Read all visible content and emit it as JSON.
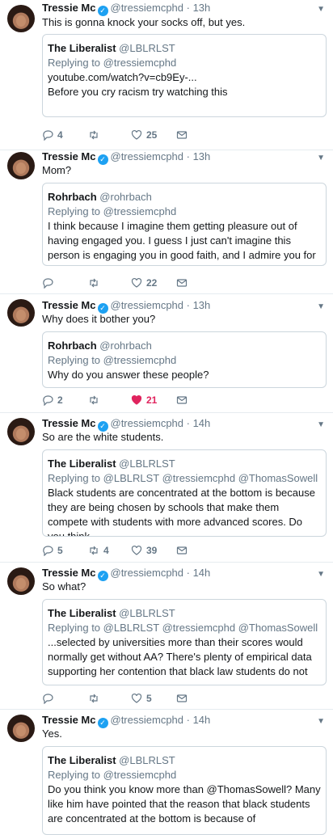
{
  "tweets": [
    {
      "name": "Tressie Mc",
      "handle": "@tressiemcphd",
      "time": "13h",
      "text": "This is gonna knock your socks off, but yes.",
      "quote": {
        "name": "The Liberalist",
        "handle": "@LBLRLST",
        "replying_label": "Replying to",
        "replying_to": "@tressiemcphd",
        "body": "youtube.com/watch?v=cb9Ey-...\nBefore you cry racism try watching this\n\nAl                    h      l                   i    t  2"
      },
      "replies": "4",
      "retweets": "",
      "likes": "25",
      "liked": false
    },
    {
      "name": "Tressie Mc",
      "handle": "@tressiemcphd",
      "time": "13h",
      "text": "Mom?",
      "quote": {
        "name": "Rohrbach",
        "handle": "@rohrbach",
        "replying_label": "Replying to",
        "replying_to": "@tressiemcphd",
        "body": "I think because I imagine them getting pleasure out of having engaged you. I guess I just can't imagine this person is engaging you in good faith, and I admire you for"
      },
      "replies": "",
      "retweets": "",
      "likes": "22",
      "liked": false
    },
    {
      "name": "Tressie Mc",
      "handle": "@tressiemcphd",
      "time": "13h",
      "text": "Why does it bother you?",
      "quote": {
        "name": "Rohrbach",
        "handle": "@rohrbach",
        "replying_label": "Replying to",
        "replying_to": "@tressiemcphd",
        "body": "Why do you answer these people?"
      },
      "replies": "2",
      "retweets": "",
      "likes": "21",
      "liked": true
    },
    {
      "name": "Tressie Mc",
      "handle": "@tressiemcphd",
      "time": "14h",
      "text": "So are the white students.",
      "quote": {
        "name": "The Liberalist",
        "handle": "@LBLRLST",
        "replying_label": "Replying to",
        "replying_to": "@LBLRLST @tressiemcphd @ThomasSowell",
        "body": "Black students are concentrated at the bottom is because they are being chosen by schools that make them compete with students with more advanced scores. Do you think"
      },
      "replies": "5",
      "retweets": "4",
      "likes": "39",
      "liked": false
    },
    {
      "name": "Tressie Mc",
      "handle": "@tressiemcphd",
      "time": "14h",
      "text": "So what?",
      "quote": {
        "name": "The Liberalist",
        "handle": "@LBLRLST",
        "replying_label": "Replying to",
        "replying_to": "@LBLRLST @tressiemcphd @ThomasSowell",
        "body": "...selected by universities more than their scores would normally get without AA? There's plenty of empirical data supporting her contention that black law students do not"
      },
      "replies": "",
      "retweets": "",
      "likes": "5",
      "liked": false
    },
    {
      "name": "Tressie Mc",
      "handle": "@tressiemcphd",
      "time": "14h",
      "text": "Yes.",
      "quote": {
        "name": "The Liberalist",
        "handle": "@LBLRLST",
        "replying_label": "Replying to",
        "replying_to": "@tressiemcphd",
        "body": "Do you think you know more than @ThomasSowell? Many like him have pointed that the reason that black students are concentrated at the bottom is because of"
      },
      "replies": "",
      "retweets": "",
      "likes": "",
      "liked": false
    }
  ],
  "colors": {
    "like_active": "#e0245e",
    "verified": "#1da1f2",
    "muted": "#657786"
  },
  "icons": {
    "reply": "reply-icon",
    "retweet": "retweet-icon",
    "like": "heart-icon",
    "message": "direct-message-icon",
    "verified": "verified-badge-icon"
  }
}
